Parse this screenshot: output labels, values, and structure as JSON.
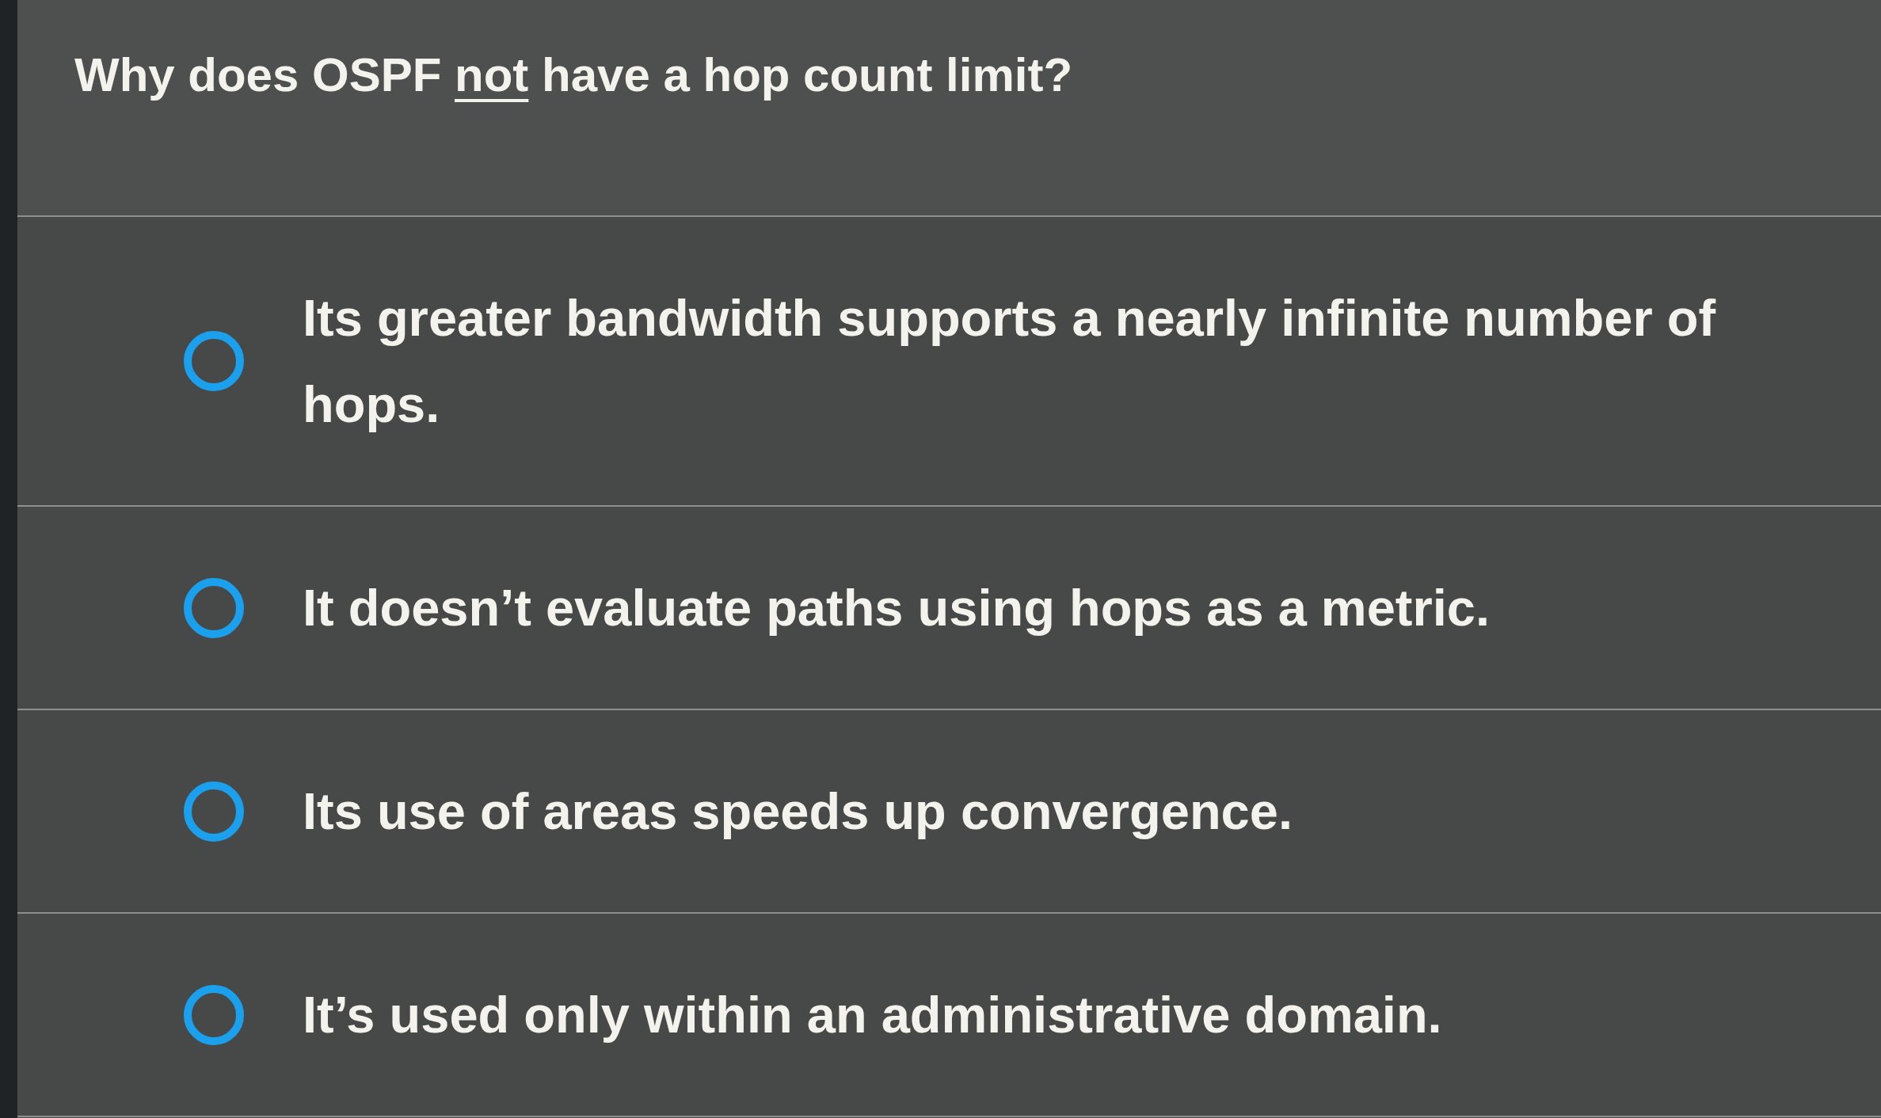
{
  "question": {
    "segments": [
      {
        "text": "Why does OSPF ",
        "underline": false
      },
      {
        "text": "not",
        "underline": true
      },
      {
        "text": " have a hop count limit?",
        "underline": false
      }
    ]
  },
  "options": [
    {
      "label": "Its greater bandwidth supports a nearly infinite number of hops.",
      "selected": false
    },
    {
      "label": "It doesn’t evaluate paths using hops as a metric.",
      "selected": false
    },
    {
      "label": "Its use of areas speeds up convergence.",
      "selected": false
    },
    {
      "label": "It’s used only within an administrative domain.",
      "selected": false
    }
  ]
}
